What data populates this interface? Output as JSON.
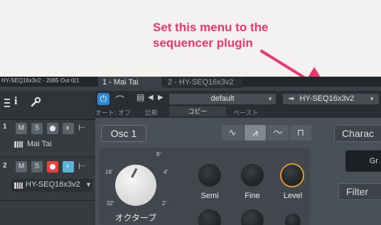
{
  "annotation": {
    "line1": "Set this menu to the",
    "line2": "sequencer plugin",
    "color": "#f0346e"
  },
  "header": {
    "clipped_title": "HY-SEQ16x3v2 - 2085 Out 0(1",
    "tab_active": "1 - Mai Tai",
    "tab_inactive": "2 - HY-SEQ16x3v2"
  },
  "tracks_toolbar": {
    "info_icon": "info-icon",
    "wrench_icon": "wrench-icon"
  },
  "tracks": [
    {
      "number": "1",
      "mute": "M",
      "solo": "S",
      "name": "Mai Tai",
      "record_active": false,
      "monitor_active": false
    },
    {
      "number": "2",
      "mute": "M",
      "solo": "S",
      "name": "HY-SEQ16x3v2",
      "record_active": true,
      "monitor_active": true
    }
  ],
  "plugin_toolbar": {
    "preset": "default",
    "instrument_menu": "HY-SEQ16x3v2",
    "auto_off": "オート: オフ",
    "compare": "比較",
    "copy": "コピー",
    "paste": "ペースト"
  },
  "synth": {
    "osc_label": "Osc 1",
    "waveforms": [
      "sine-wave-icon",
      "saw-wave-icon",
      "triangle-wave-icon",
      "square-wave-icon"
    ],
    "selected_waveform": 1,
    "octave_label": "オクターブ",
    "octave_ticks": {
      "top": "8'",
      "left": "16'",
      "right": "4'",
      "bottom_left": "32'",
      "bottom_right": "2'"
    },
    "knobs": [
      "Semi",
      "Fine",
      "Level"
    ],
    "right_panel": {
      "character": "Charac",
      "gr": "Gr",
      "filter": "Filter"
    }
  },
  "colors": {
    "accent_blue": "#2a8ad8",
    "record_red": "#e74040",
    "monitor_blue": "#5bb4d8",
    "level_orange": "#e39a2d"
  }
}
